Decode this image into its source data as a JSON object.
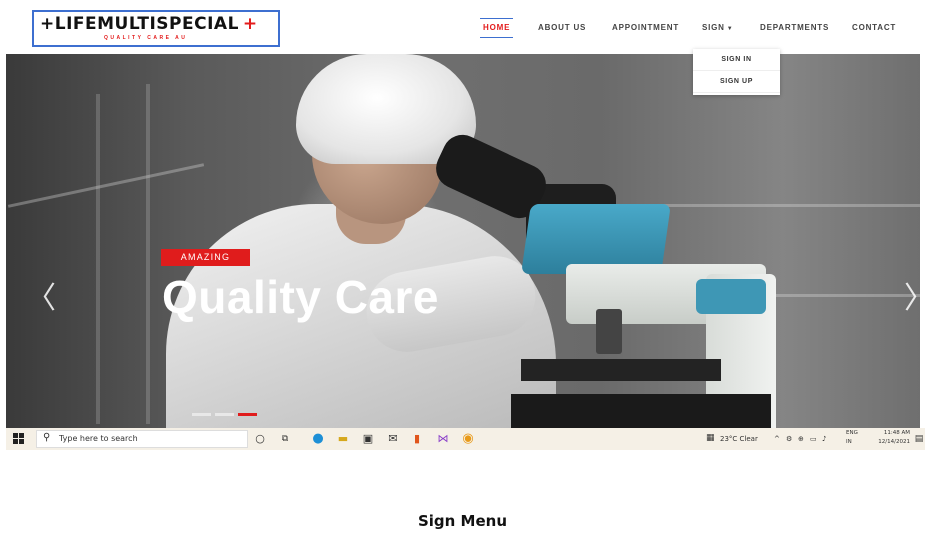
{
  "header": {
    "logo_name": "+LIFEMULTISPECIAL",
    "logo_cross": "+",
    "logo_tagline": "QUALITY CARE AU"
  },
  "nav": {
    "home": "HOME",
    "about": "ABOUT US",
    "appointment": "APPOINTMENT",
    "sign": "SIGN",
    "departments": "DEPARTMENTS",
    "contact": "CONTACT",
    "active": "HOME"
  },
  "dropdown": {
    "sign_in": "SIGN IN",
    "sign_up": "SIGN UP"
  },
  "hero": {
    "badge": "AMAZING",
    "title": "Quality Care",
    "prev_glyph": "〈",
    "next_glyph": "〉",
    "slide_count": 3,
    "active_slide": 3
  },
  "taskbar": {
    "search_placeholder": "Type here to search",
    "weather": "23°C  Clear",
    "lang_top": "ENG",
    "lang_bottom": "IN",
    "time": "11:48 AM",
    "date": "12/14/2021"
  },
  "caption": "Sign Menu",
  "colors": {
    "accent_red": "#e01c1c",
    "nav_active_border": "#3d6fd0",
    "taskbar_bg": "#f5f0e6"
  }
}
